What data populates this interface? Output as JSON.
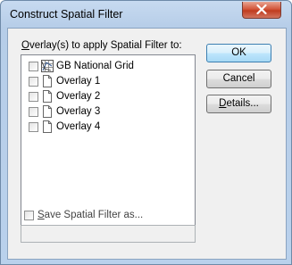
{
  "dialog": {
    "title": "Construct Spatial Filter"
  },
  "overlays_label": {
    "prefix": "",
    "accel": "O",
    "suffix": "verlay(s) to apply Spatial Filter to:"
  },
  "overlays": [
    {
      "label": "GB National Grid",
      "checked": false,
      "icon": "grid-layer-icon"
    },
    {
      "label": "Overlay 1",
      "checked": false,
      "icon": "document-icon"
    },
    {
      "label": "Overlay 2",
      "checked": false,
      "icon": "document-icon"
    },
    {
      "label": "Overlay 3",
      "checked": false,
      "icon": "document-icon"
    },
    {
      "label": "Overlay 4",
      "checked": false,
      "icon": "document-icon"
    }
  ],
  "buttons": {
    "ok": "OK",
    "cancel": "Cancel",
    "details_accel": "D",
    "details_rest": "etails..."
  },
  "save": {
    "accel": "S",
    "rest": "ave Spatial Filter as...",
    "checked": false,
    "filename": ""
  },
  "colors": {
    "close_button": "#c83e22",
    "default_button_border": "#3c7fb1"
  }
}
